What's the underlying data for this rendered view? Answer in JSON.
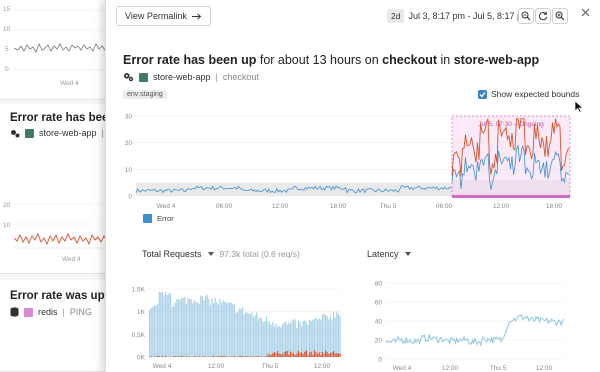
{
  "background": {
    "card1": {
      "y_ticks": [
        "15",
        "10",
        "5",
        "0"
      ],
      "x_label": "Wed 4"
    },
    "card2": {
      "title": "Error rate has been",
      "service": "store-web-app",
      "y_ticks": [
        "20",
        "10"
      ],
      "x_label": "Wed 4"
    },
    "card3": {
      "title": "Error rate was up fo",
      "service": "redis",
      "service_tag": "PING"
    }
  },
  "toolbar": {
    "permalink_label": "View Permalink",
    "range_badge": "2d",
    "range_text": "Jul 3, 8:17 pm - Jul 5, 8:17 pm"
  },
  "header": {
    "title_prefix": "Error rate has been up",
    "title_mid": " for about 13 hours on ",
    "title_resource": "checkout",
    "title_in": " in ",
    "title_service": "store-web-app",
    "service": "store-web-app",
    "service_kind": "checkout",
    "env_tag": "env:staging",
    "bounds_label": "Show expected bounds"
  },
  "main_chart": {
    "y_ticks": [
      "30",
      "20",
      "10",
      "0"
    ],
    "x_ticks": [
      "Wed 4",
      "06:00",
      "12:00",
      "18:00",
      "Thu 5",
      "06:00",
      "12:00",
      "18:00"
    ],
    "anomaly_label": "Jul 5, 07:30 – Ongoing",
    "legend_label": "Error"
  },
  "chart_data": [
    {
      "type": "line",
      "title": "",
      "series": [
        {
          "name": "Error"
        }
      ],
      "ylim": [
        0,
        30
      ],
      "x": [
        "Wed 4",
        "06:00",
        "12:00",
        "18:00",
        "Thu 5",
        "06:00",
        "12:00",
        "18:00"
      ],
      "baseline_values": [
        2,
        3,
        2,
        3,
        2,
        3
      ],
      "anomaly_values": [
        12,
        22,
        17,
        27,
        13,
        24,
        19,
        28,
        15,
        23,
        18,
        25,
        14
      ]
    },
    {
      "type": "bar",
      "title": "Total Requests",
      "ylim": [
        0,
        1500
      ],
      "x": [
        "Wed 4",
        "12:00",
        "Thu 5",
        "12:00"
      ]
    },
    {
      "type": "line",
      "title": "Latency",
      "ylim": [
        0,
        80
      ],
      "x": [
        "Wed 4",
        "12:00",
        "Thu 5",
        "12:00"
      ],
      "values": [
        18,
        20,
        19,
        22,
        21,
        19,
        20,
        18,
        21,
        20,
        42,
        44,
        41,
        40,
        39
      ]
    }
  ],
  "requests": {
    "label": "Total Requests",
    "summary": "97.3k total (0.6 req/s)",
    "y_ticks": [
      "1.5K",
      "1K",
      "0.5K",
      "0K"
    ],
    "x_ticks": [
      "Wed 4",
      "12:00",
      "Thu 5",
      "12:00"
    ]
  },
  "latency": {
    "label": "Latency",
    "y_ticks": [
      "80",
      "60",
      "40",
      "20",
      "0"
    ],
    "x_ticks": [
      "Wed 4",
      "12:00",
      "Thu 5",
      "12:00"
    ]
  },
  "colors": {
    "error_blue": "#3f8fcf",
    "anomaly_red": "#d9532c",
    "service_green": "#3e7a66",
    "redis_pink": "#d98ad3",
    "anomaly_band": "#f6d7ef",
    "anomaly_border": "#d36cc0"
  }
}
